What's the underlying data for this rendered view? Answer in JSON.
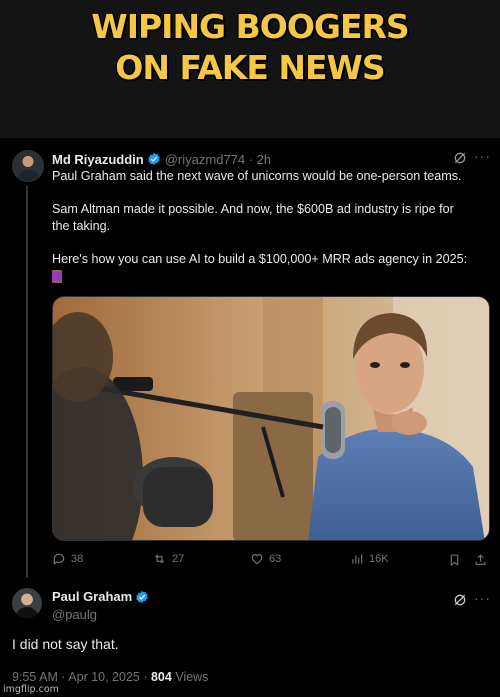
{
  "meme": {
    "title_line1": "WIPING BOOGERS",
    "title_line2": "ON FAKE NEWS",
    "title_color": "#f6c744",
    "watermark": "imgflip.com"
  },
  "tweet1": {
    "author_name": "Md Riyazuddin",
    "handle_time": "@riyazmd774 · 2h",
    "lines": [
      "Paul Graham said the next wave of unicorns would be one-person teams.",
      "Sam Altman made it possible. And now, the $600B ad industry is ripe for",
      "the taking.",
      "Here's how you can use AI to build a $100,000+ MRR ads agency in 2025:"
    ],
    "emoji": "thread-spool-emoji",
    "media": "photo-man-at-podcast-microphone",
    "actions": {
      "replies": "38",
      "reposts": "27",
      "likes": "63",
      "views": "16K"
    }
  },
  "tweet2": {
    "author_name": "Paul Graham",
    "handle": "@paulg",
    "text": "I did not say that.",
    "timestamp": "9:55 AM · Apr 10, 2025 · ",
    "views_count": "804",
    "views_label": " Views"
  },
  "colors": {
    "verified_blue": "#1d9bf0",
    "muted_gray": "#71767b",
    "text": "#e7e9ea",
    "background": "#000000"
  },
  "icons": [
    "verified-badge-icon",
    "grok-icon",
    "more-icon",
    "reply-icon",
    "repost-icon",
    "like-icon",
    "views-icon",
    "bookmark-icon",
    "share-icon"
  ]
}
